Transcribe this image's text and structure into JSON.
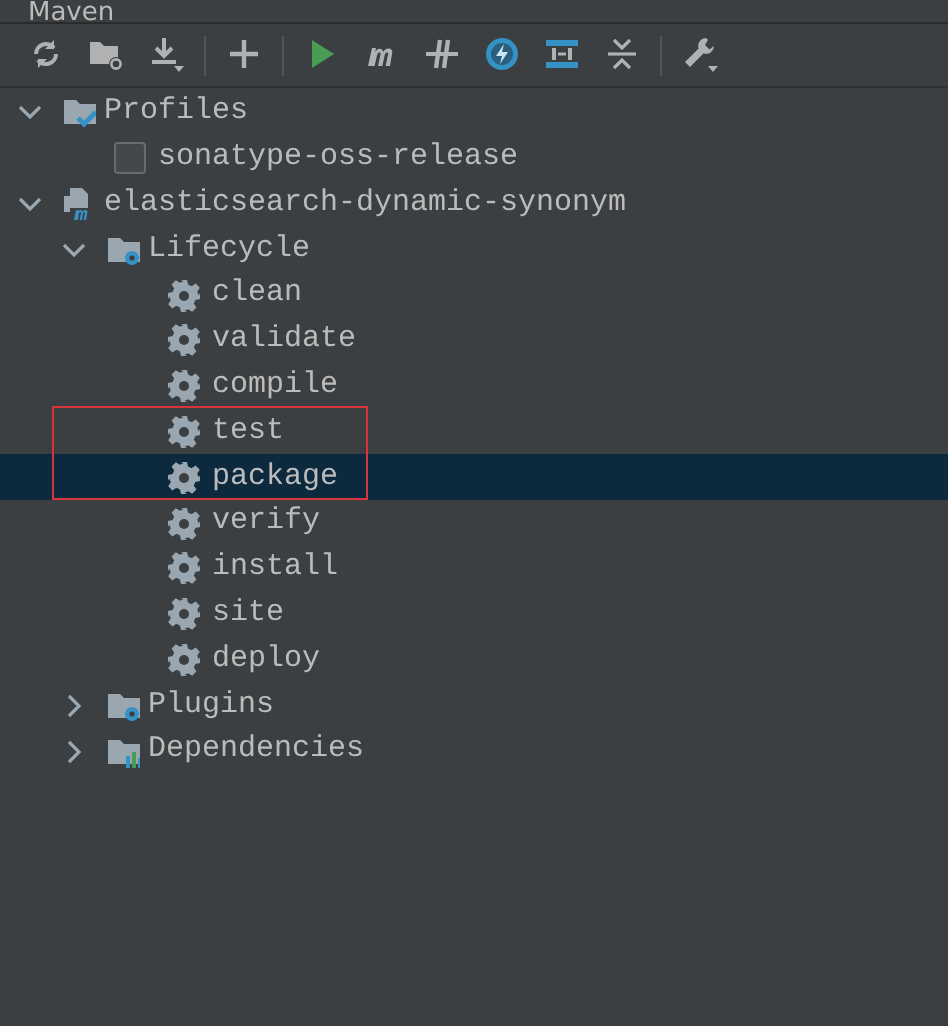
{
  "window": {
    "title": "Maven"
  },
  "toolbar": [
    {
      "kind": "reload"
    },
    {
      "kind": "folder-sync"
    },
    {
      "kind": "download",
      "dropdown": true
    },
    {
      "kind": "separator"
    },
    {
      "kind": "add"
    },
    {
      "kind": "separator"
    },
    {
      "kind": "run"
    },
    {
      "kind": "maven"
    },
    {
      "kind": "skip"
    },
    {
      "kind": "offline"
    },
    {
      "kind": "layout"
    },
    {
      "kind": "collapse"
    },
    {
      "kind": "separator"
    },
    {
      "kind": "settings",
      "dropdown": true
    }
  ],
  "tree": [
    {
      "kind": "profiles",
      "label": "Profiles",
      "expanded": true,
      "selected": false,
      "children": [
        {
          "kind": "profile",
          "label": "sonatype-oss-release",
          "checked": false,
          "selected": false
        }
      ]
    },
    {
      "kind": "module",
      "label": "elasticsearch-dynamic-synonym",
      "expanded": true,
      "selected": false,
      "children": [
        {
          "kind": "lifecycle",
          "label": "Lifecycle",
          "expanded": true,
          "selected": false,
          "children": [
            {
              "kind": "goal",
              "label": "clean",
              "selected": false
            },
            {
              "kind": "goal",
              "label": "validate",
              "selected": false
            },
            {
              "kind": "goal",
              "label": "compile",
              "selected": false
            },
            {
              "kind": "goal",
              "label": "test",
              "selected": false
            },
            {
              "kind": "goal",
              "label": "package",
              "selected": true,
              "boxed": true
            },
            {
              "kind": "goal",
              "label": "verify",
              "selected": false
            },
            {
              "kind": "goal",
              "label": "install",
              "selected": false
            },
            {
              "kind": "goal",
              "label": "site",
              "selected": false
            },
            {
              "kind": "goal",
              "label": "deploy",
              "selected": false
            }
          ]
        },
        {
          "kind": "plugins",
          "label": "Plugins",
          "expanded": false,
          "selected": false
        },
        {
          "kind": "dependencies",
          "label": "Dependencies",
          "expanded": false,
          "selected": false
        }
      ]
    }
  ]
}
